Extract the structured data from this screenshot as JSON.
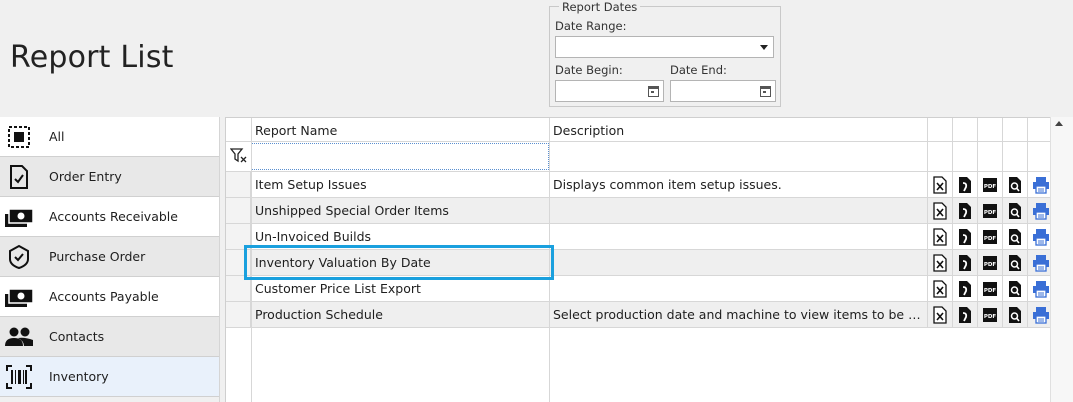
{
  "page": {
    "title": "Report List"
  },
  "report_dates": {
    "legend": "Report Dates",
    "date_range_label": "Date Range:",
    "date_range_value": "",
    "date_begin_label": "Date Begin:",
    "date_begin_value": "",
    "date_end_label": "Date End:",
    "date_end_value": ""
  },
  "sidebar": {
    "items": [
      {
        "label": "All",
        "icon": "all-icon"
      },
      {
        "label": "Order Entry",
        "icon": "order-entry-icon"
      },
      {
        "label": "Accounts Receivable",
        "icon": "money-icon"
      },
      {
        "label": "Purchase Order",
        "icon": "shield-check-icon"
      },
      {
        "label": "Accounts Payable",
        "icon": "money-icon"
      },
      {
        "label": "Contacts",
        "icon": "people-icon"
      },
      {
        "label": "Inventory",
        "icon": "barcode-icon"
      }
    ]
  },
  "grid": {
    "columns": {
      "name": "Report Name",
      "description": "Description"
    },
    "filter_value": "",
    "rows": [
      {
        "name": "Item Setup Issues",
        "description": "Displays common item setup issues."
      },
      {
        "name": "Unshipped Special Order Items",
        "description": ""
      },
      {
        "name": "Un-Invoiced Builds",
        "description": ""
      },
      {
        "name": "Inventory Valuation By Date",
        "description": ""
      },
      {
        "name": "Customer Price List Export",
        "description": ""
      },
      {
        "name": "Production Schedule",
        "description": "Select production date and machine to view items to be p..."
      }
    ],
    "actions": [
      "excel-icon",
      "word-icon",
      "pdf-icon",
      "preview-icon",
      "print-icon"
    ],
    "pdf_badge": "PDF",
    "accent_print": "#3a6fd6",
    "selection_color": "#1aa0de"
  }
}
